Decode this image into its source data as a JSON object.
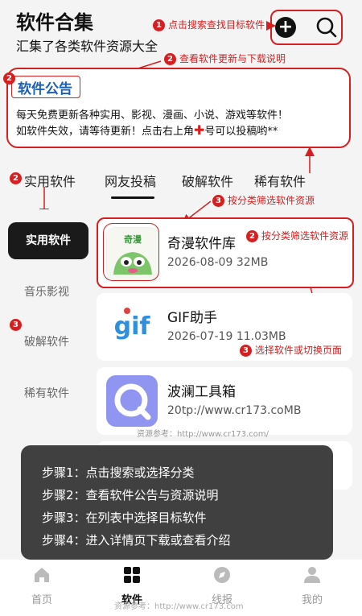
{
  "header": {
    "title": "软件合集",
    "subtitle": "汇集了各类软件资源大全",
    "add_icon_glyph": "+",
    "search_icon": "search-icon"
  },
  "annotations": {
    "a1": {
      "num": "1",
      "text": "点击搜索查找目标软件"
    },
    "a2": {
      "num": "2",
      "text": "查看软件更新与下载说明"
    },
    "a3": {
      "num": "2"
    },
    "a4": {
      "num": "2"
    },
    "a5": {
      "num": "3",
      "text": "按分类筛选软件资源"
    },
    "a6": {
      "num": "2",
      "text": "按分类筛选软件资源"
    },
    "a7": {
      "num": "3"
    },
    "a8": {
      "num": "3",
      "text": "选择软件或切换页面"
    }
  },
  "notice": {
    "title": "软件公告",
    "line1": "每天免费更新各种实用、影视、漫画、小说、游戏等软件！",
    "line2_a": "如软件失效，请等待更新！点击右上角",
    "plus": "✚",
    "line2_b": "号可以投稿哟**"
  },
  "tabs": [
    {
      "label": "实用软件"
    },
    {
      "label": "网友投稿"
    },
    {
      "label": "破解软件"
    },
    {
      "label": "稀有软件"
    }
  ],
  "sidebar": {
    "items": [
      {
        "label": "实用软件"
      },
      {
        "label": "音乐影视"
      },
      {
        "label": "破解软件"
      },
      {
        "label": "稀有软件"
      }
    ]
  },
  "apps": [
    {
      "name": "奇漫软件库",
      "icon_text": "奇漫",
      "date": "2026-08-09",
      "size": "32MB"
    },
    {
      "name": "GIF助手",
      "icon_text": "gif",
      "date": "2026-07-19",
      "size": "11.03MB"
    },
    {
      "name": "波澜工具箱",
      "meta": "20tp://www.cr173.coMB"
    }
  ],
  "watermark": "资源参考：http://www.cr173.com/",
  "steps": [
    "步骤1：点击搜索或选择分类",
    "步骤2：查看软件公告与资源说明",
    "步骤3：在列表中选择目标软件",
    "步骤4：进入详情页下载或查看介绍"
  ],
  "bottom_nav": [
    {
      "label": "首页",
      "icon": "home-icon"
    },
    {
      "label": "软件",
      "icon": "apps-grid-icon"
    },
    {
      "label": "线报",
      "icon": "compass-icon"
    },
    {
      "label": "我的",
      "icon": "user-icon"
    }
  ],
  "bottom_watermark": "资源参考：http://www.cr173.com",
  "colors": {
    "accent": "#d42020",
    "text": "#222222",
    "overlay": "#3c3c3c"
  }
}
